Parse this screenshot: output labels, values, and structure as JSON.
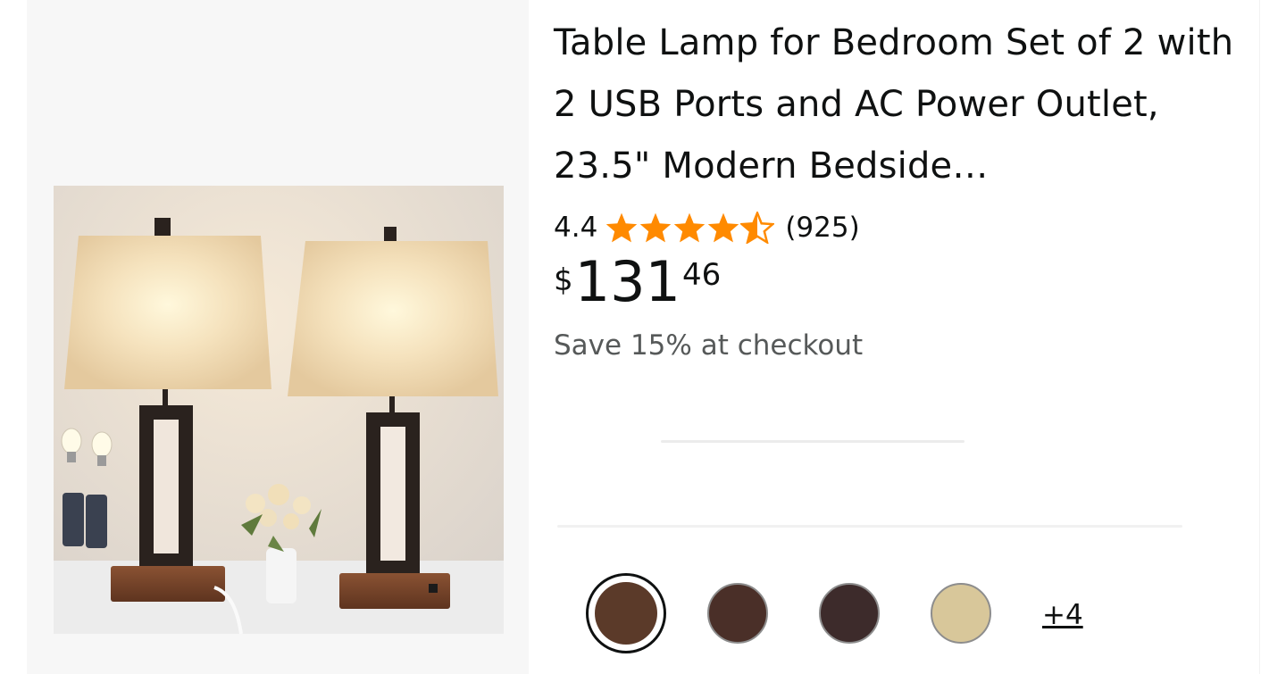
{
  "product": {
    "title": "Table Lamp for Bedroom Set of 2 with 2 USB Ports and AC Power Outlet, 23.5\" Modern Bedside…",
    "rating": "4.4",
    "rating_value": 4.4,
    "review_count": "(925)",
    "price": {
      "symbol": "$",
      "whole": "131",
      "fraction": "46"
    },
    "promo": "Save 15% at checkout",
    "more_variants": "+4"
  },
  "swatches": [
    {
      "name": "brown",
      "color": "#5b3a29",
      "selected": true
    },
    {
      "name": "dark-brown",
      "color": "#4a2f28",
      "selected": false
    },
    {
      "name": "espresso",
      "color": "#3d2b2b",
      "selected": false
    },
    {
      "name": "beige",
      "color": "#d8c79a",
      "selected": false
    }
  ],
  "colors": {
    "star": "#ff8a00",
    "text": "#0f1111",
    "muted": "#565959",
    "image_bg": "#f7f7f7"
  }
}
